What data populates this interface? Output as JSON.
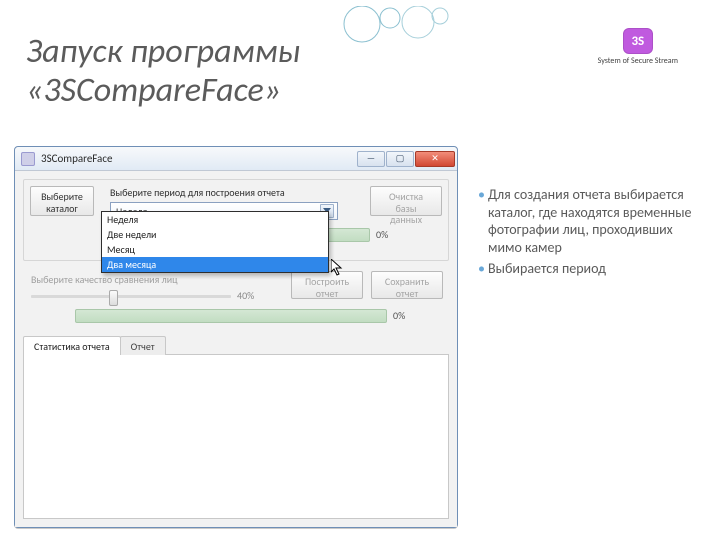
{
  "slide": {
    "title_line1": "Запуск программы",
    "title_line2": "«3SCompareFace»"
  },
  "logo": {
    "badge": "3S",
    "caption": "System of Secure Stream"
  },
  "window": {
    "title": "3SCompareFace",
    "buttons": {
      "select_catalog": "Выберите каталог",
      "cleanup_db": "Очистка базы данных",
      "build_report": "Построить отчет",
      "save_report": "Сохранить отчет"
    },
    "labels": {
      "period": "Выберите период для построения отчета",
      "quality": "Выберите качество сравнения лиц"
    },
    "combo": {
      "selected": "Неделя",
      "options": [
        "Неделя",
        "Две недели",
        "Месяц",
        "Два месяца"
      ],
      "highlighted_index": 3
    },
    "progress_top_pct": "0%",
    "slider_pct": "40%",
    "progress_bottom_pct": "0%",
    "tabs": {
      "stats": "Статистика отчета",
      "report": "Отчет"
    }
  },
  "bullets": {
    "b1": "Для создания отчета выбирается каталог, где находятся временные фотографии лиц, проходивших мимо камер",
    "b2": "Выбирается период"
  }
}
